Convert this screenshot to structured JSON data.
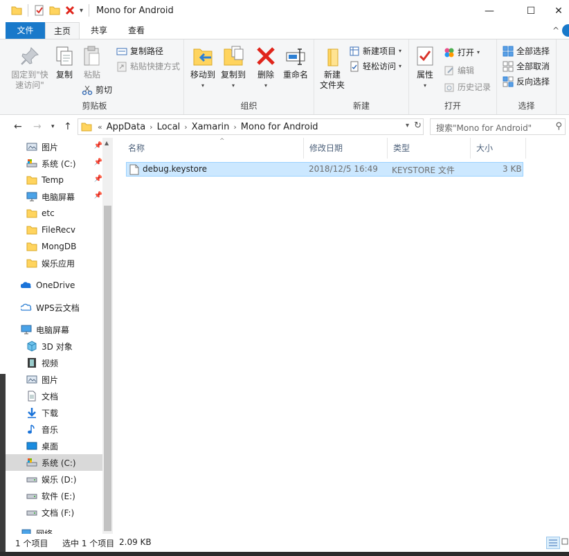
{
  "window": {
    "title": "Mono for Android",
    "minimize": "—",
    "maximize": "☐",
    "close": "✕"
  },
  "tabs": {
    "file": "文件",
    "home": "主页",
    "share": "共享",
    "view": "查看"
  },
  "ribbon": {
    "clipboard": {
      "label": "剪贴板",
      "pin": "固定到\"快速访问\"",
      "copy": "复制",
      "paste": "粘贴",
      "copy_path": "复制路径",
      "paste_shortcut": "粘贴快捷方式",
      "cut": "剪切"
    },
    "organize": {
      "label": "组织",
      "move_to": "移动到",
      "copy_to": "复制到",
      "delete": "删除",
      "rename": "重命名"
    },
    "new": {
      "label": "新建",
      "new_folder_line1": "新建",
      "new_folder_line2": "文件夹",
      "new_item": "新建项目",
      "easy_access": "轻松访问"
    },
    "open": {
      "label": "打开",
      "properties": "属性",
      "open": "打开",
      "edit": "编辑",
      "history": "历史记录"
    },
    "select": {
      "label": "选择",
      "select_all": "全部选择",
      "select_none": "全部取消",
      "invert": "反向选择"
    }
  },
  "address": {
    "prefix": "«",
    "crumbs": [
      "AppData",
      "Local",
      "Xamarin",
      "Mono for Android"
    ],
    "search_placeholder": "搜索\"Mono for Android\""
  },
  "nav": {
    "items": [
      {
        "label": "图片",
        "icon": "pictures-icon",
        "pinned": true
      },
      {
        "label": "系统 (C:)",
        "icon": "drive-c-icon",
        "pinned": true
      },
      {
        "label": "Temp",
        "icon": "folder-icon",
        "pinned": true
      },
      {
        "label": "电脑屏幕",
        "icon": "monitor-icon",
        "pinned": true
      },
      {
        "label": "etc",
        "icon": "folder-icon"
      },
      {
        "label": "FileRecv",
        "icon": "folder-icon"
      },
      {
        "label": "MongDB",
        "icon": "folder-icon"
      },
      {
        "label": "娱乐应用",
        "icon": "folder-icon"
      },
      {
        "label": "OneDrive",
        "icon": "onedrive-icon"
      },
      {
        "label": "WPS云文档",
        "icon": "cloud-icon"
      },
      {
        "label": "电脑屏幕",
        "icon": "monitor-icon"
      },
      {
        "label": "3D 对象",
        "icon": "cube-icon"
      },
      {
        "label": "视频",
        "icon": "video-icon"
      },
      {
        "label": "图片",
        "icon": "pictures-icon"
      },
      {
        "label": "文档",
        "icon": "document-icon"
      },
      {
        "label": "下载",
        "icon": "download-icon"
      },
      {
        "label": "音乐",
        "icon": "music-icon"
      },
      {
        "label": "桌面",
        "icon": "desktop-icon"
      },
      {
        "label": "系统 (C:)",
        "icon": "drive-c-icon",
        "selected": true
      },
      {
        "label": "娱乐 (D:)",
        "icon": "drive-icon"
      },
      {
        "label": "软件 (E:)",
        "icon": "drive-icon"
      },
      {
        "label": "文档 (F:)",
        "icon": "drive-icon"
      },
      {
        "label": "网络",
        "icon": "network-icon"
      }
    ]
  },
  "columns": {
    "name": "名称",
    "date": "修改日期",
    "type": "类型",
    "size": "大小"
  },
  "files": [
    {
      "name": "debug.keystore",
      "date": "2018/12/5 16:49",
      "type": "KEYSTORE 文件",
      "size": "3 KB"
    }
  ],
  "status": {
    "count": "1 个项目",
    "selected": "选中 1 个项目",
    "size": "2.09 KB"
  },
  "colors": {
    "accent": "#1979ca",
    "selection": "#cce8ff",
    "folder": "#ffd45e",
    "delete_red": "#e0251b"
  }
}
